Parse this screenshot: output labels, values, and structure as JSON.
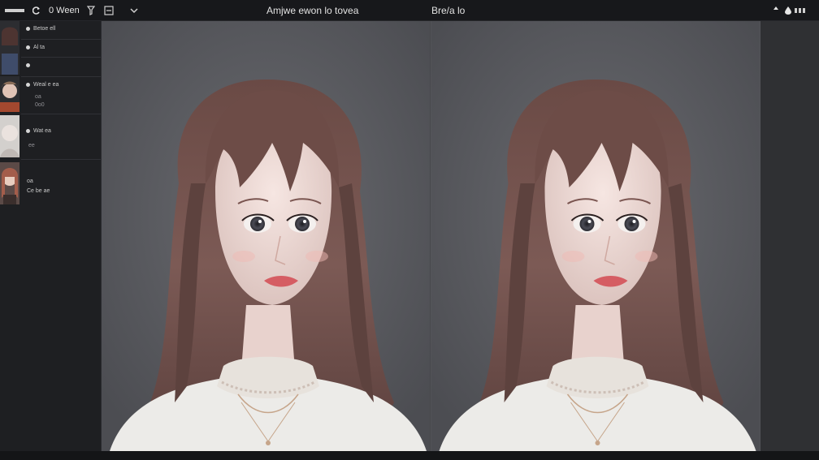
{
  "toolbar": {
    "view_label": "0  Ween",
    "left_title": "Amjwe ewon lo tovea",
    "right_title": "Bre/a lo",
    "right_icons": [
      "pin-icon",
      "drop-icon",
      "bars-icon"
    ]
  },
  "sidebar": {
    "items": [
      {
        "label": "Betoe ell"
      },
      {
        "label": "Al ta"
      },
      {
        "label": ""
      },
      {
        "label": "Weal e ea",
        "sub1": "oa",
        "sub2": "0o0"
      },
      {
        "label": "Wat ea",
        "sub1": "ee"
      },
      {
        "label": "oa",
        "sub1": "Ce be ae"
      }
    ]
  },
  "canvas": {
    "left_bg": "#55565a",
    "right_bg": "#58595d"
  }
}
